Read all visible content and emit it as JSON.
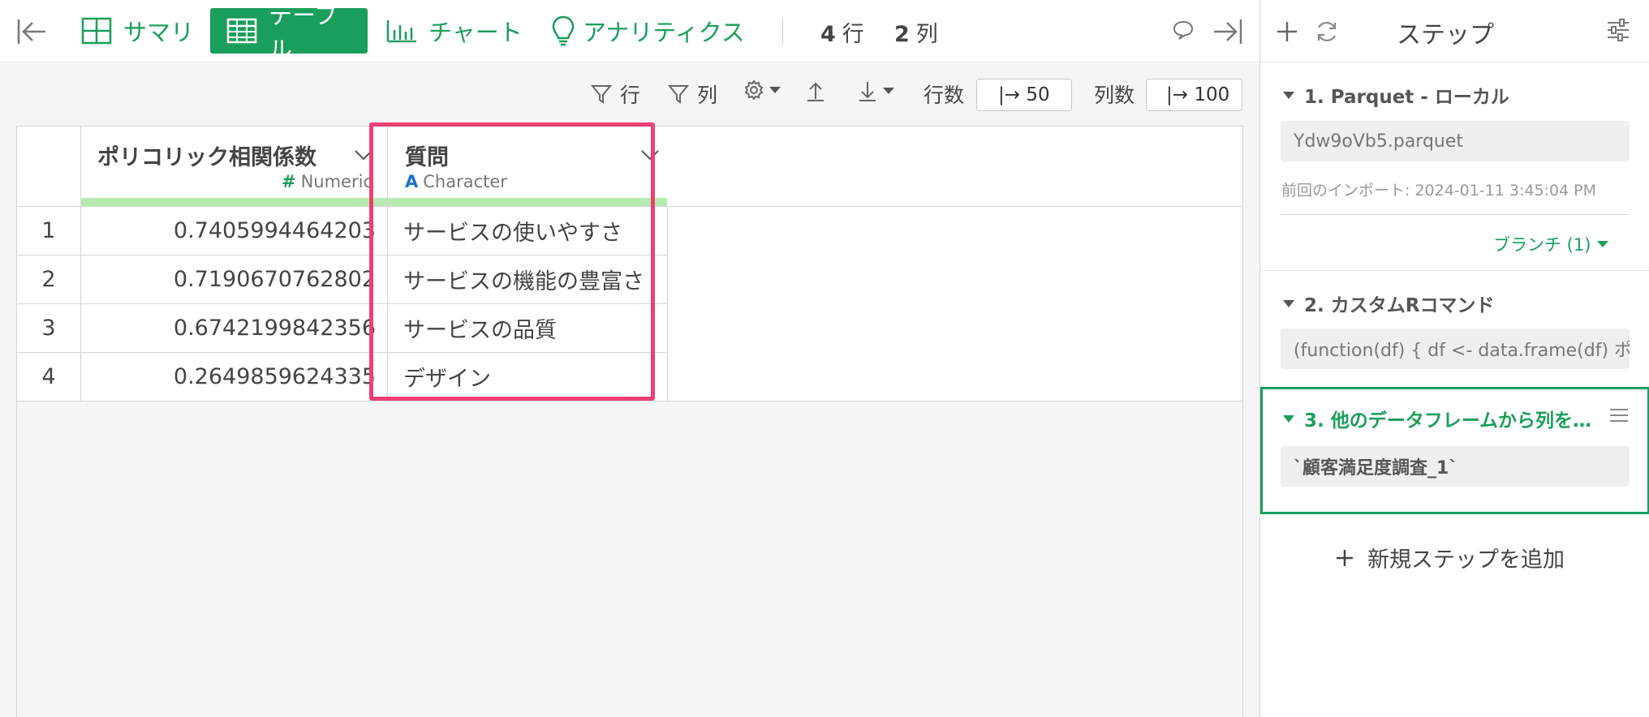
{
  "toolbar": {
    "tabs": [
      {
        "label": "サマリ"
      },
      {
        "label": "テーブル"
      },
      {
        "label": "チャート"
      },
      {
        "label": "アナリティクス"
      }
    ],
    "rows_num": "4",
    "rows_unit": "行",
    "cols_num": "2",
    "cols_unit": "列"
  },
  "subbar": {
    "filter_rows": "行",
    "filter_cols": "列",
    "row_count_label": "行数",
    "row_count_value": "|→ 50",
    "col_count_label": "列数",
    "col_count_value": "|→ 100"
  },
  "table": {
    "columns": [
      {
        "name": "ポリコリック相関係数",
        "type": "Numeric",
        "type_symbol": "#"
      },
      {
        "name": "質問",
        "type": "Character",
        "type_symbol": "A"
      }
    ],
    "rows": [
      {
        "index": "1",
        "value": "0.7405994464203",
        "question": "サービスの使いやすさ"
      },
      {
        "index": "2",
        "value": "0.7190670762802",
        "question": "サービスの機能の豊富さ"
      },
      {
        "index": "3",
        "value": "0.6742199842356",
        "question": "サービスの品質"
      },
      {
        "index": "4",
        "value": "0.2649859624335",
        "question": "デザイン"
      }
    ]
  },
  "panel": {
    "title": "ステップ",
    "steps": [
      {
        "title": "1. Parquet - ローカル",
        "content": "Ydw9oVb5.parquet",
        "meta": "前回のインポート: 2024-01-11 3:45:04 PM",
        "branch": "ブランチ (1)"
      },
      {
        "title": "2. カスタムRコマンド",
        "content": "(function(df) { df <- data.frame(df) ポ…"
      },
      {
        "title": "3. 他のデータフレームから列を…",
        "content": "`顧客満足度調査_1`"
      }
    ],
    "add_step": "新規ステップを追加"
  },
  "colors": {
    "accent": "#1a9e5c",
    "highlight": "#ef3f75",
    "numeric_bar": "#b7ecb0",
    "character_icon": "#1a73c8"
  }
}
